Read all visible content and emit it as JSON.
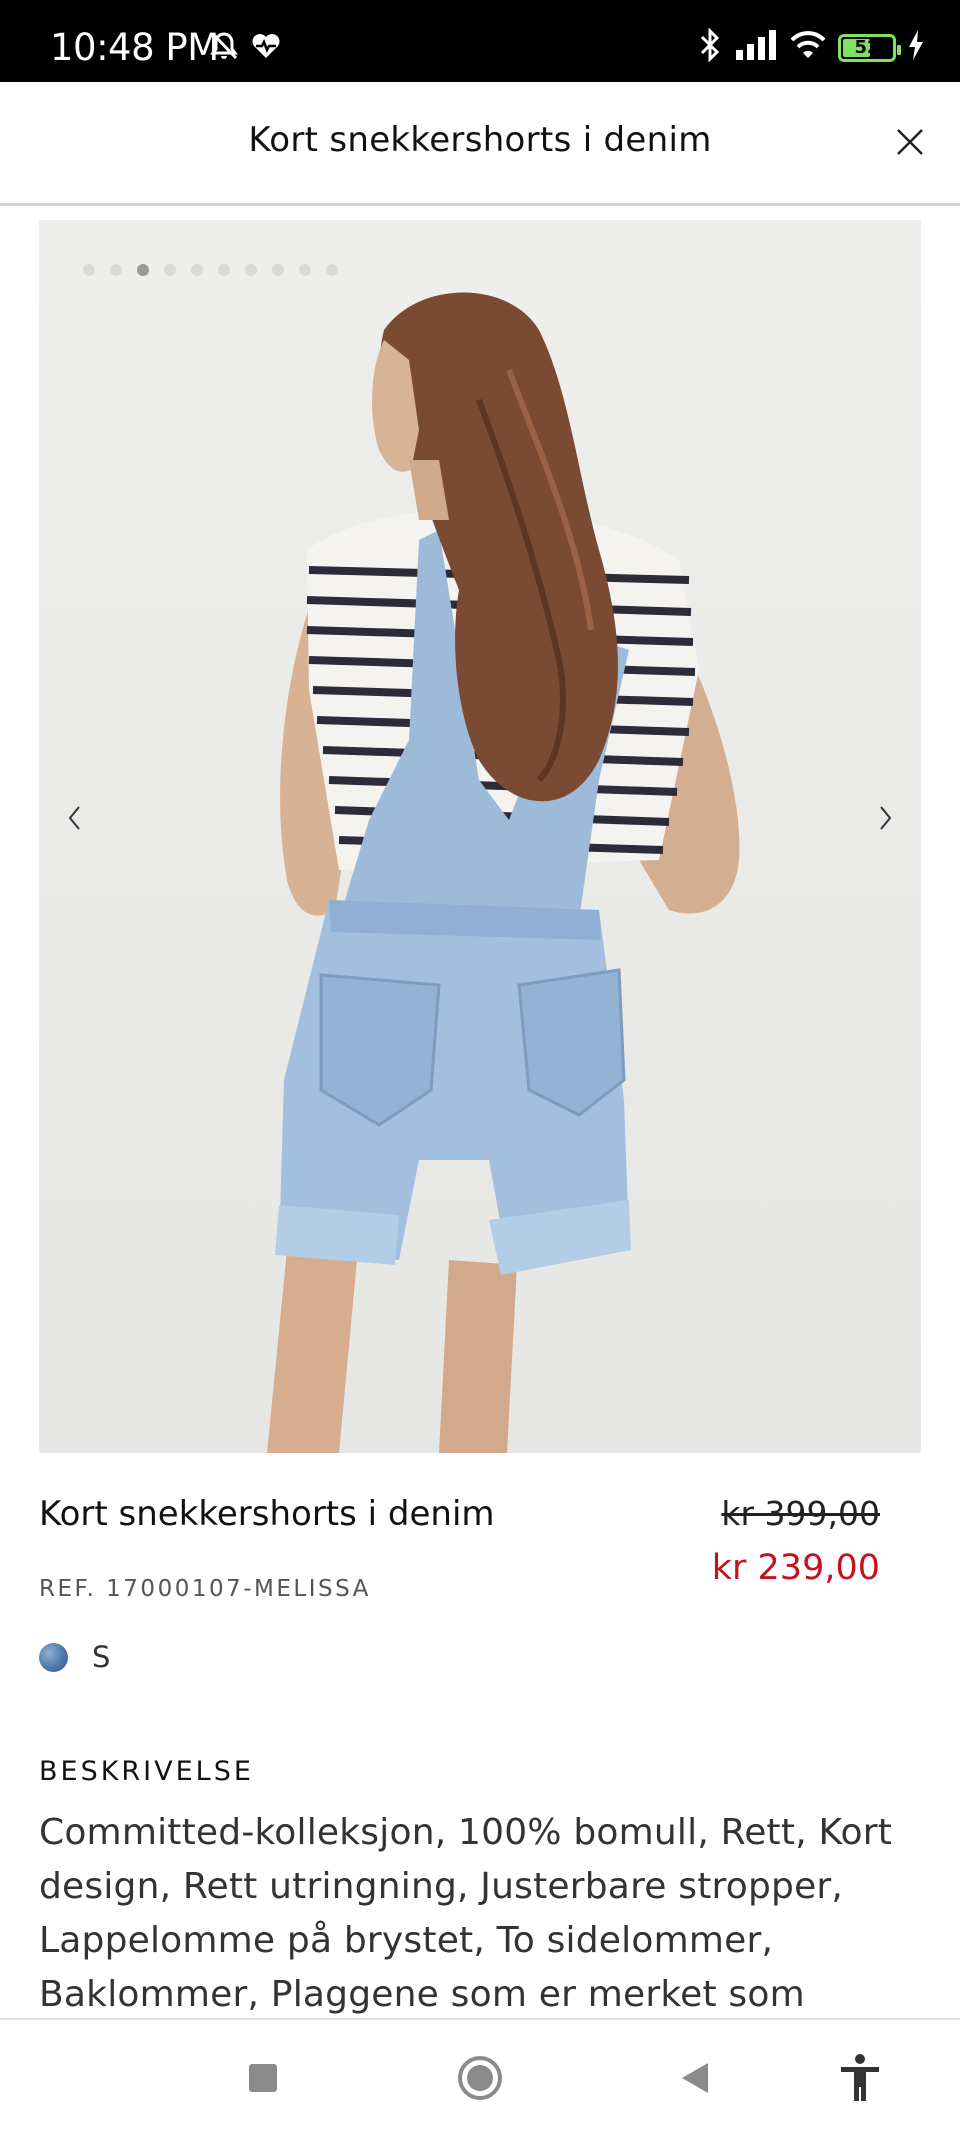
{
  "status_bar": {
    "time": "10:48 PM",
    "battery_level": "52",
    "battery_fraction": 0.52,
    "icons": [
      "notifications-off-icon",
      "heart-pulse-icon",
      "bluetooth-icon",
      "signal-icon",
      "wifi-icon",
      "battery-icon",
      "charging-icon"
    ]
  },
  "header": {
    "title": "Kort snekkershorts i denim",
    "close_icon": "close-icon"
  },
  "gallery": {
    "image_count": 10,
    "active_index": 2,
    "prev_icon": "chevron-left-icon",
    "next_icon": "chevron-right-icon"
  },
  "product": {
    "name": "Kort snekkershorts i denim",
    "old_price": "kr 399,00",
    "new_price": "kr 239,00",
    "ref": "REF. 17000107-MELISSA",
    "size": "S",
    "color_swatch": "#4e78aa"
  },
  "description": {
    "heading": "BESKRIVELSE",
    "text": "Committed-kolleksjon, 100% bomull, Rett, Kort design, Rett utringning, Justerbare stropper, Lappelomme på brystet, To sidelommer, Baklommer, Plaggene som er merket som"
  },
  "nav": {
    "items": [
      "recents-square-icon",
      "home-circle-icon",
      "back-triangle-icon",
      "accessibility-icon"
    ]
  },
  "colors": {
    "sale_price": "#c4131c",
    "battery": "#7ee35f"
  }
}
